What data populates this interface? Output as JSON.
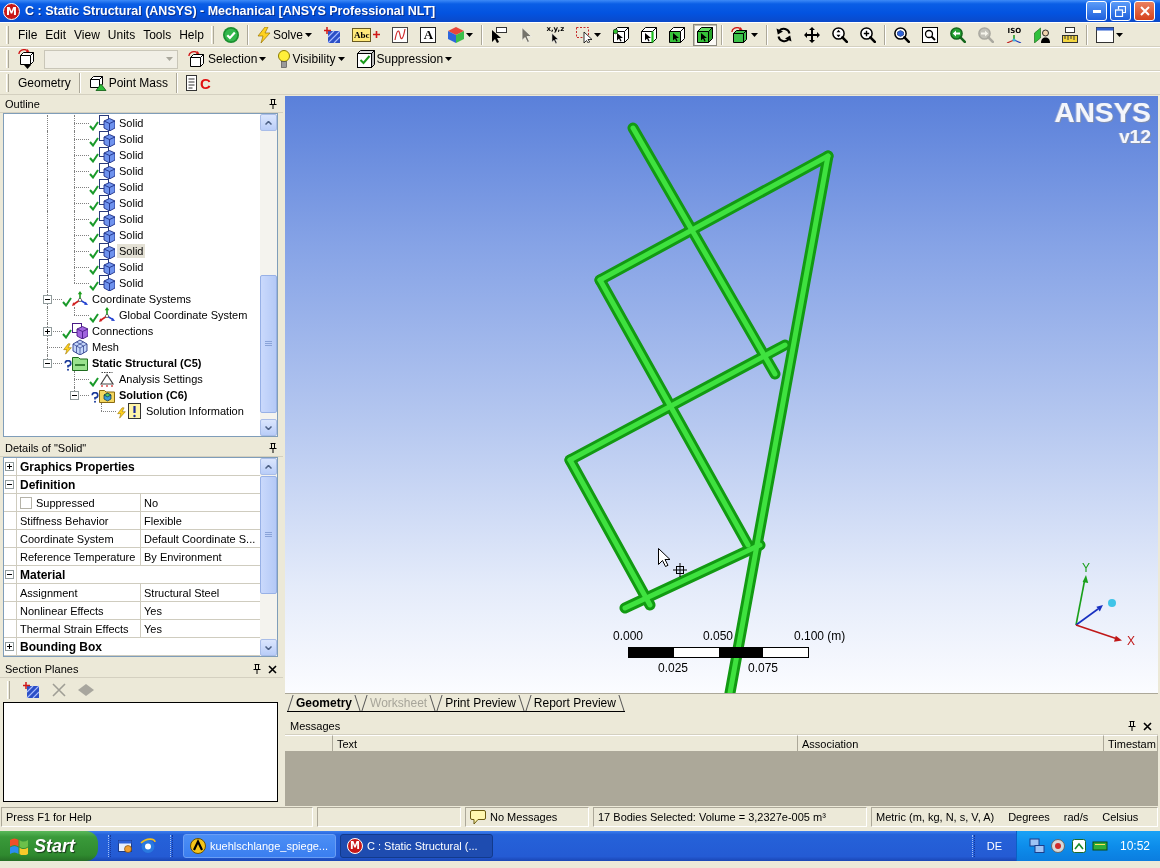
{
  "window": {
    "icon_letter": "M",
    "title": "C : Static Structural (ANSYS) - Mechanical [ANSYS Professional NLT]"
  },
  "menu": [
    {
      "label": "File"
    },
    {
      "label": "Edit"
    },
    {
      "label": "View"
    },
    {
      "label": "Units"
    },
    {
      "label": "Tools"
    },
    {
      "label": "Help"
    }
  ],
  "main_toolbar": [
    [
      {
        "kind": "update",
        "dropdown": false,
        "disabled": false
      }
    ],
    [
      {
        "kind": "solve",
        "label": "Solve",
        "dropdown": true,
        "disabled": false
      },
      {
        "kind": "section_plane",
        "dropdown": false,
        "disabled": false
      },
      {
        "kind": "annotation",
        "glyph": "Abc",
        "dropdown": false,
        "disabled": false
      },
      {
        "kind": "chart",
        "dropdown": false,
        "disabled": false
      },
      {
        "kind": "comment",
        "glyph": "A",
        "dropdown": false,
        "disabled": false
      },
      {
        "kind": "cube_colors",
        "dropdown": true,
        "disabled": false
      }
    ],
    [
      {
        "kind": "pick_label",
        "dropdown": false,
        "disabled": false,
        "selected": false
      },
      {
        "kind": "pointer",
        "dropdown": false,
        "disabled": true,
        "selected": false
      },
      {
        "kind": "pick_xyz",
        "glyph": "x,y,z",
        "dropdown": false,
        "disabled": false,
        "selected": false
      },
      {
        "kind": "box_select",
        "dropdown": true,
        "disabled": false,
        "selected": false
      },
      {
        "kind": "select_vertex",
        "dropdown": false,
        "disabled": false,
        "selected": false
      },
      {
        "kind": "select_edge",
        "dropdown": false,
        "disabled": false,
        "selected": false
      },
      {
        "kind": "select_face",
        "dropdown": false,
        "disabled": false,
        "selected": false
      },
      {
        "kind": "select_body",
        "dropdown": false,
        "disabled": false,
        "selected": true
      }
    ],
    [
      {
        "kind": "cube_arrows",
        "dropdown": true,
        "disabled": false
      }
    ],
    [
      {
        "kind": "rotate",
        "dropdown": false,
        "disabled": false
      },
      {
        "kind": "pan",
        "dropdown": false,
        "disabled": false
      },
      {
        "kind": "zoom",
        "dropdown": false,
        "disabled": false
      },
      {
        "kind": "zoom_in",
        "dropdown": false,
        "disabled": false
      }
    ],
    [
      {
        "kind": "zoom_fit",
        "dropdown": false,
        "disabled": false
      },
      {
        "kind": "zoom_box",
        "dropdown": false,
        "disabled": false
      },
      {
        "kind": "previous_view",
        "dropdown": false,
        "disabled": false
      },
      {
        "kind": "next_view",
        "dropdown": false,
        "disabled": true
      },
      {
        "kind": "iso",
        "glyph": "ISO",
        "dropdown": false,
        "disabled": false
      },
      {
        "kind": "look_at",
        "dropdown": false,
        "disabled": false
      },
      {
        "kind": "ruler",
        "dropdown": false,
        "disabled": false
      }
    ],
    [
      {
        "kind": "layout",
        "dropdown": true,
        "disabled": false
      }
    ]
  ],
  "selection_toolbar": {
    "combo": {
      "disabled": true
    },
    "menus": [
      {
        "kind": "selection",
        "label": "Selection"
      },
      {
        "kind": "visibility",
        "label": "Visibility"
      },
      {
        "kind": "suppression",
        "label": "Suppression"
      }
    ]
  },
  "geometry_toolbar": [
    {
      "kind": "geometry",
      "label": "Geometry"
    },
    {
      "kind": "point_mass",
      "label": "Point Mass"
    },
    {
      "kind": "commands",
      "glyph": "C"
    }
  ],
  "outline": {
    "title": "Outline",
    "tree": [
      {
        "children": [
          {
            "kind": "solid",
            "label": "Solid",
            "defined": true,
            "up_to_date": true,
            "bold": false,
            "selected": false
          },
          {
            "kind": "solid",
            "label": "Solid",
            "defined": true,
            "up_to_date": true,
            "bold": false,
            "selected": false
          },
          {
            "kind": "solid",
            "label": "Solid",
            "defined": true,
            "up_to_date": true,
            "bold": false,
            "selected": false
          },
          {
            "kind": "solid",
            "label": "Solid",
            "defined": true,
            "up_to_date": true,
            "bold": false,
            "selected": false
          },
          {
            "kind": "solid",
            "label": "Solid",
            "defined": true,
            "up_to_date": true,
            "bold": false,
            "selected": false
          },
          {
            "kind": "solid",
            "label": "Solid",
            "defined": true,
            "up_to_date": true,
            "bold": false,
            "selected": false
          },
          {
            "kind": "solid",
            "label": "Solid",
            "defined": true,
            "up_to_date": true,
            "bold": false,
            "selected": false
          },
          {
            "kind": "solid",
            "label": "Solid",
            "defined": true,
            "up_to_date": true,
            "bold": false,
            "selected": false
          },
          {
            "kind": "solid",
            "label": "Solid",
            "defined": true,
            "up_to_date": true,
            "bold": false,
            "selected": true
          },
          {
            "kind": "solid",
            "label": "Solid",
            "defined": true,
            "up_to_date": true,
            "bold": false,
            "selected": false
          },
          {
            "kind": "solid",
            "label": "Solid",
            "defined": true,
            "up_to_date": true,
            "bold": false,
            "selected": false
          }
        ]
      },
      {
        "kind": "coordinate_systems",
        "label": "Coordinate Systems",
        "defined": true,
        "up_to_date": true,
        "bold": false,
        "selected": false,
        "expanded": true,
        "children": [
          {
            "kind": "coordinate_system",
            "label": "Global Coordinate System",
            "defined": true,
            "up_to_date": true,
            "bold": false,
            "selected": false
          }
        ]
      },
      {
        "kind": "connections",
        "label": "Connections",
        "defined": true,
        "up_to_date": true,
        "bold": false,
        "selected": false,
        "expanded": false
      },
      {
        "kind": "mesh",
        "label": "Mesh",
        "defined": true,
        "up_to_date": false,
        "bold": false,
        "selected": false
      },
      {
        "kind": "environment",
        "label": "Static Structural (C5)",
        "defined": false,
        "up_to_date": true,
        "bold": true,
        "selected": false,
        "expanded": true,
        "children": [
          {
            "kind": "analysis_settings",
            "label": "Analysis Settings",
            "defined": true,
            "up_to_date": true,
            "bold": false,
            "selected": false
          },
          {
            "kind": "solution",
            "label": "Solution (C6)",
            "defined": false,
            "up_to_date": true,
            "bold": true,
            "selected": false,
            "expanded": true,
            "children": [
              {
                "kind": "solution_information",
                "label": "Solution Information",
                "defined": true,
                "up_to_date": false,
                "bold": false,
                "selected": false
              }
            ]
          }
        ]
      }
    ]
  },
  "details": {
    "title": "Details of \"Solid\"",
    "rows": [
      {
        "kind": "group",
        "label": "Graphics Properties",
        "expanded": false
      },
      {
        "kind": "group",
        "label": "Definition",
        "expanded": true
      },
      {
        "kind": "checkbox",
        "label": "Suppressed",
        "value": "No",
        "checked": false
      },
      {
        "kind": "property",
        "label": "Stiffness Behavior",
        "value": "Flexible"
      },
      {
        "kind": "property",
        "label": "Coordinate System",
        "value": "Default Coordinate S..."
      },
      {
        "kind": "property",
        "label": "Reference Temperature",
        "value": "By Environment"
      },
      {
        "kind": "group",
        "label": "Material",
        "expanded": true
      },
      {
        "kind": "property",
        "label": "Assignment",
        "value": "Structural Steel"
      },
      {
        "kind": "property",
        "label": "Nonlinear Effects",
        "value": "Yes"
      },
      {
        "kind": "property",
        "label": "Thermal Strain Effects",
        "value": "Yes"
      },
      {
        "kind": "group",
        "label": "Bounding Box",
        "expanded": false
      }
    ]
  },
  "section_planes": {
    "title": "Section Planes",
    "tools": [
      {
        "kind": "new_plane",
        "disabled": false
      },
      {
        "kind": "delete",
        "disabled": true
      },
      {
        "kind": "edges",
        "disabled": true
      }
    ]
  },
  "viewport": {
    "logo": {
      "name": "ANSYS",
      "version": "v12"
    },
    "scale_bar": {
      "top_labels": [
        "0.000",
        "0.050",
        "0.100 (m)"
      ],
      "bottom_labels": [
        "0.025",
        "0.075"
      ]
    },
    "triad": {
      "y_label": "Y",
      "x_label": "X"
    }
  },
  "tabs": [
    {
      "label": "Geometry",
      "selected": true,
      "disabled": false
    },
    {
      "label": "Worksheet",
      "selected": false,
      "disabled": true
    },
    {
      "label": "Print Preview",
      "selected": false,
      "disabled": false
    },
    {
      "label": "Report Preview",
      "selected": false,
      "disabled": false
    }
  ],
  "messages": {
    "title": "Messages",
    "columns": [
      "Text",
      "Association",
      "Timestam"
    ]
  },
  "status_bar": {
    "help": "Press F1 for Help",
    "messages": "No Messages",
    "selection": "17 Bodies Selected: Volume = 3,2327e-005 m³",
    "units": [
      "Metric (m, kg, N, s, V, A)",
      "Degrees",
      "rad/s",
      "Celsius"
    ]
  },
  "taskbar": {
    "start": "Start",
    "tasks": [
      {
        "kind": "workbench",
        "label": "kuehlschlange_spiege...",
        "selected": false
      },
      {
        "kind": "mechanical",
        "icon_letter": "M",
        "label": "C : Static Structural (...",
        "selected": true
      }
    ],
    "language": "DE",
    "clock": "10:52"
  }
}
